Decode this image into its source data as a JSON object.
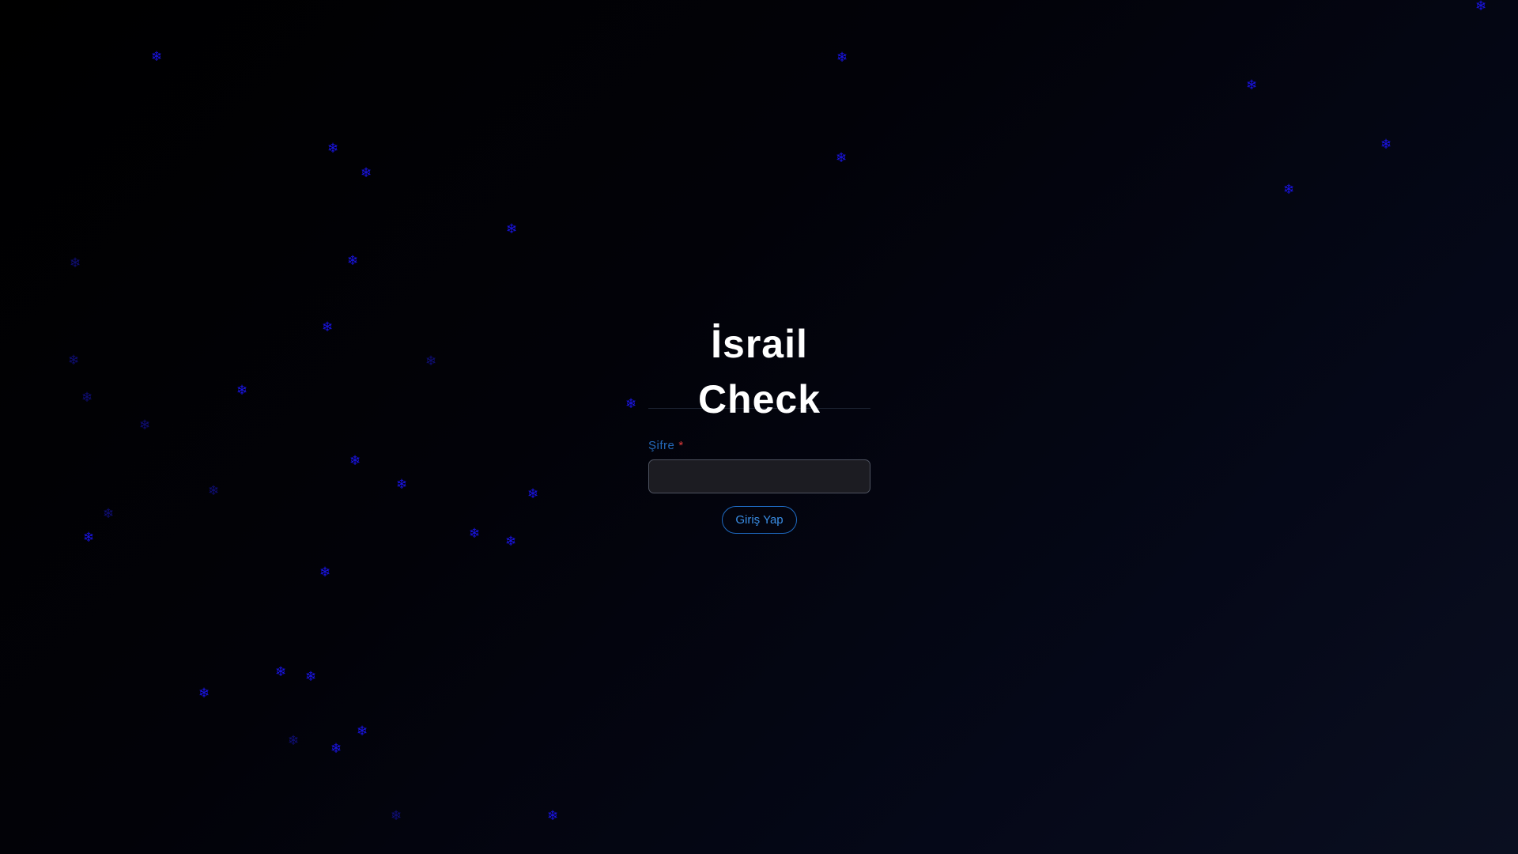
{
  "page_title": "İsrail Check",
  "snowflake": {
    "glyph": "❄",
    "icon": "snowflake-icon",
    "color": "#1a14e6"
  },
  "form": {
    "password_label": "Şifre",
    "required_mark": "*",
    "password_value": "",
    "submit_label": "Giriş Yap"
  },
  "colors": {
    "label": "#2469b9",
    "required": "#e03b3b",
    "button_border": "#1e6ac2",
    "button_text": "#3a8ee6",
    "input_bg": "#1c1c22",
    "title": "#ffffff"
  }
}
